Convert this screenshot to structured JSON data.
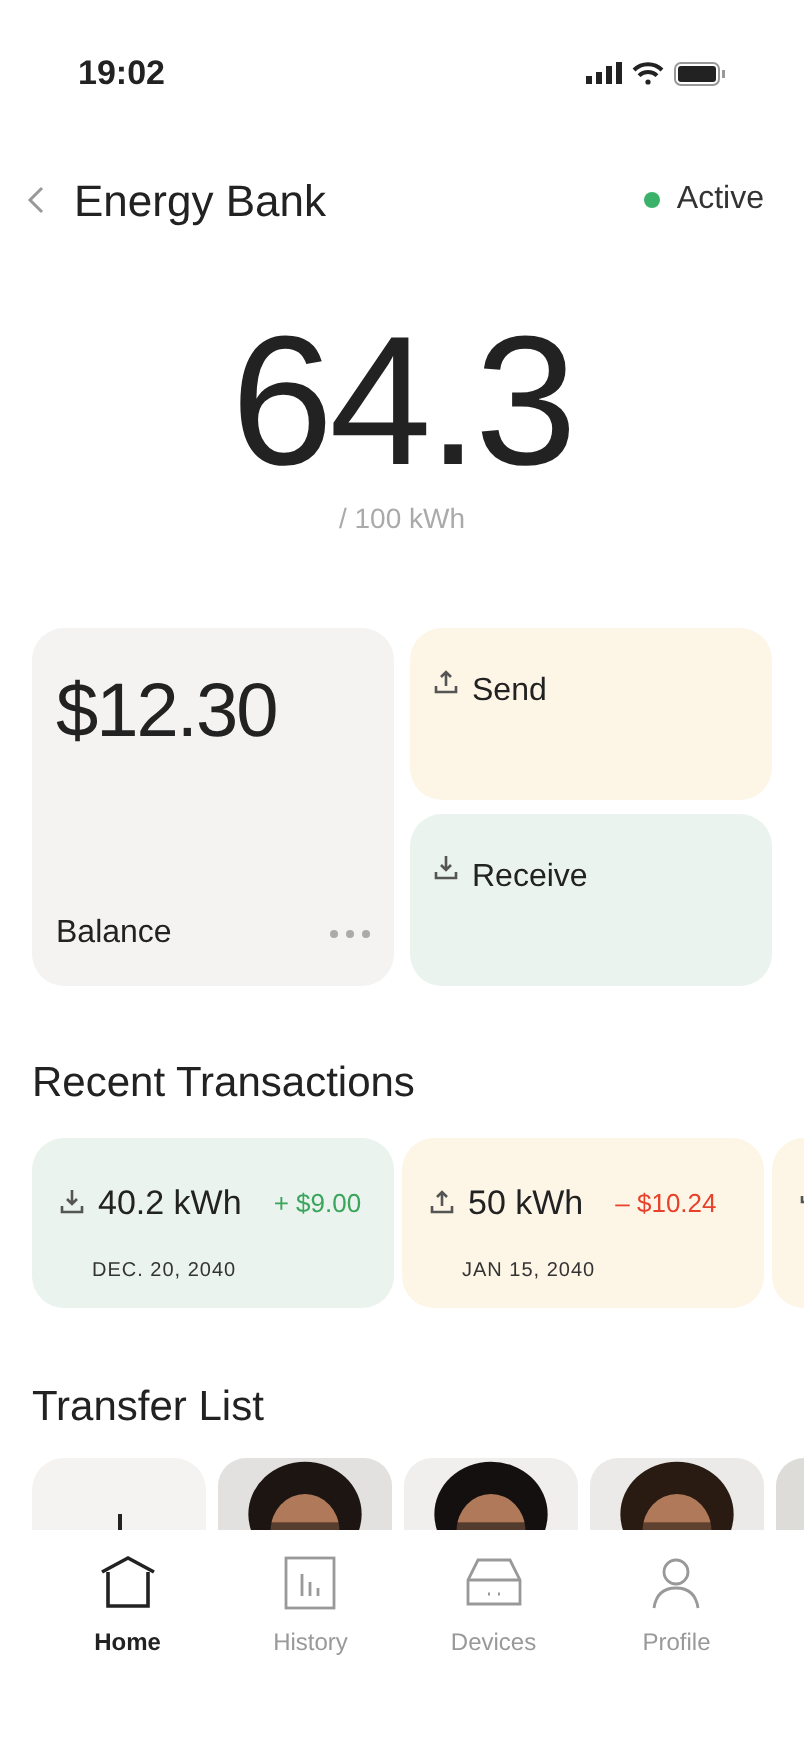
{
  "status_bar": {
    "time": "19:02"
  },
  "header": {
    "title": "Energy Bank",
    "status": {
      "label": "Active",
      "color": "#3bb26a"
    }
  },
  "energy": {
    "value": "64.3",
    "capacity": "/ 100 kWh"
  },
  "balance": {
    "amount": "$12.30",
    "label": "Balance"
  },
  "actions": [
    {
      "kind": "send",
      "label": "Send"
    },
    {
      "kind": "receive",
      "label": "Receive"
    }
  ],
  "recent_transactions": {
    "title": "Recent Transactions",
    "items": [
      {
        "kind": "receive",
        "energy": "40.2 kWh",
        "amount": "+ $9.00",
        "date": "DEC. 20, 2040"
      },
      {
        "kind": "send",
        "energy": "50 kWh",
        "amount": "– $10.24",
        "date": "JAN 15, 2040"
      },
      {
        "kind": "send"
      }
    ]
  },
  "transfer_list": {
    "title": "Transfer List",
    "items": [
      {
        "kind": "add"
      },
      {
        "kind": "picture"
      },
      {
        "kind": "picture"
      },
      {
        "kind": "picture"
      },
      {
        "kind": "picture"
      }
    ]
  },
  "tab_bar": [
    {
      "kind": "home",
      "label": "Home",
      "selected": true
    },
    {
      "kind": "history",
      "label": "History",
      "selected": false
    },
    {
      "kind": "devices",
      "label": "Devices",
      "selected": false
    },
    {
      "kind": "profile",
      "label": "Profile",
      "selected": false
    }
  ]
}
